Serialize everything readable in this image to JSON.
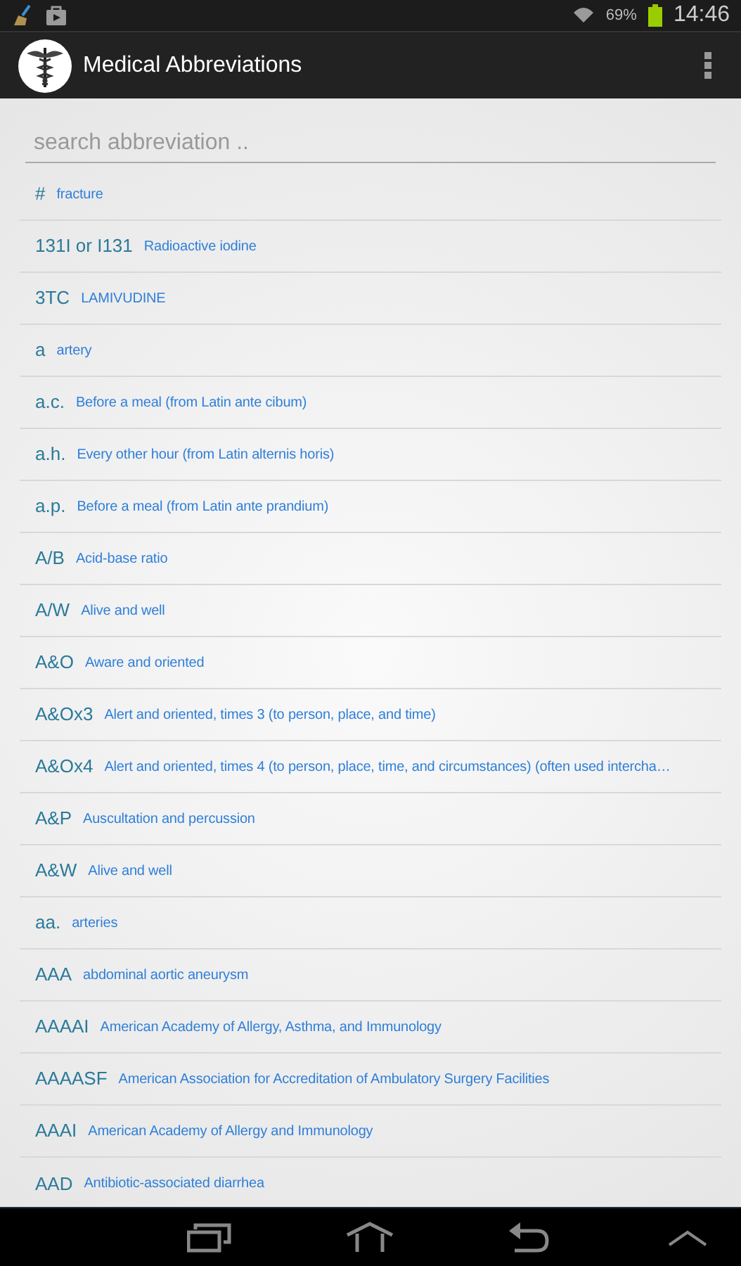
{
  "status_bar": {
    "battery": "69%",
    "time": "14:46"
  },
  "action_bar": {
    "title": "Medical Abbreviations"
  },
  "search": {
    "placeholder": "search abbreviation .."
  },
  "rows": [
    {
      "abbr": "#",
      "meaning": "fracture"
    },
    {
      "abbr": "131I or I131",
      "meaning": "Radioactive iodine"
    },
    {
      "abbr": "3TC",
      "meaning": "LAMIVUDINE"
    },
    {
      "abbr": "a",
      "meaning": "artery"
    },
    {
      "abbr": "a.c.",
      "meaning": "Before a meal (from Latin ante cibum)"
    },
    {
      "abbr": "a.h.",
      "meaning": "Every other hour (from Latin alternis horis)"
    },
    {
      "abbr": "a.p.",
      "meaning": "Before a meal (from Latin ante prandium)"
    },
    {
      "abbr": "A/B",
      "meaning": "Acid-base ratio"
    },
    {
      "abbr": "A/W",
      "meaning": "Alive and well"
    },
    {
      "abbr": "A&O",
      "meaning": "Aware and oriented"
    },
    {
      "abbr": "A&Ox3",
      "meaning": "Alert and oriented, times 3 (to person, place, and time)"
    },
    {
      "abbr": "A&Ox4",
      "meaning": "Alert and oriented, times 4 (to person, place, time, and circumstances) (often used intercha…"
    },
    {
      "abbr": "A&P",
      "meaning": "Auscultation and percussion"
    },
    {
      "abbr": "A&W",
      "meaning": "Alive and well"
    },
    {
      "abbr": "aa.",
      "meaning": "arteries"
    },
    {
      "abbr": "AAA",
      "meaning": "abdominal aortic aneurysm"
    },
    {
      "abbr": "AAAAI",
      "meaning": "American Academy of Allergy, Asthma, and Immunology"
    },
    {
      "abbr": "AAAASF",
      "meaning": "American Association for Accreditation of Ambulatory Surgery Facilities"
    },
    {
      "abbr": "AAAI",
      "meaning": "American Academy of Allergy and Immunology"
    },
    {
      "abbr": "AAD",
      "meaning": "Antibiotic-associated diarrhea"
    }
  ]
}
